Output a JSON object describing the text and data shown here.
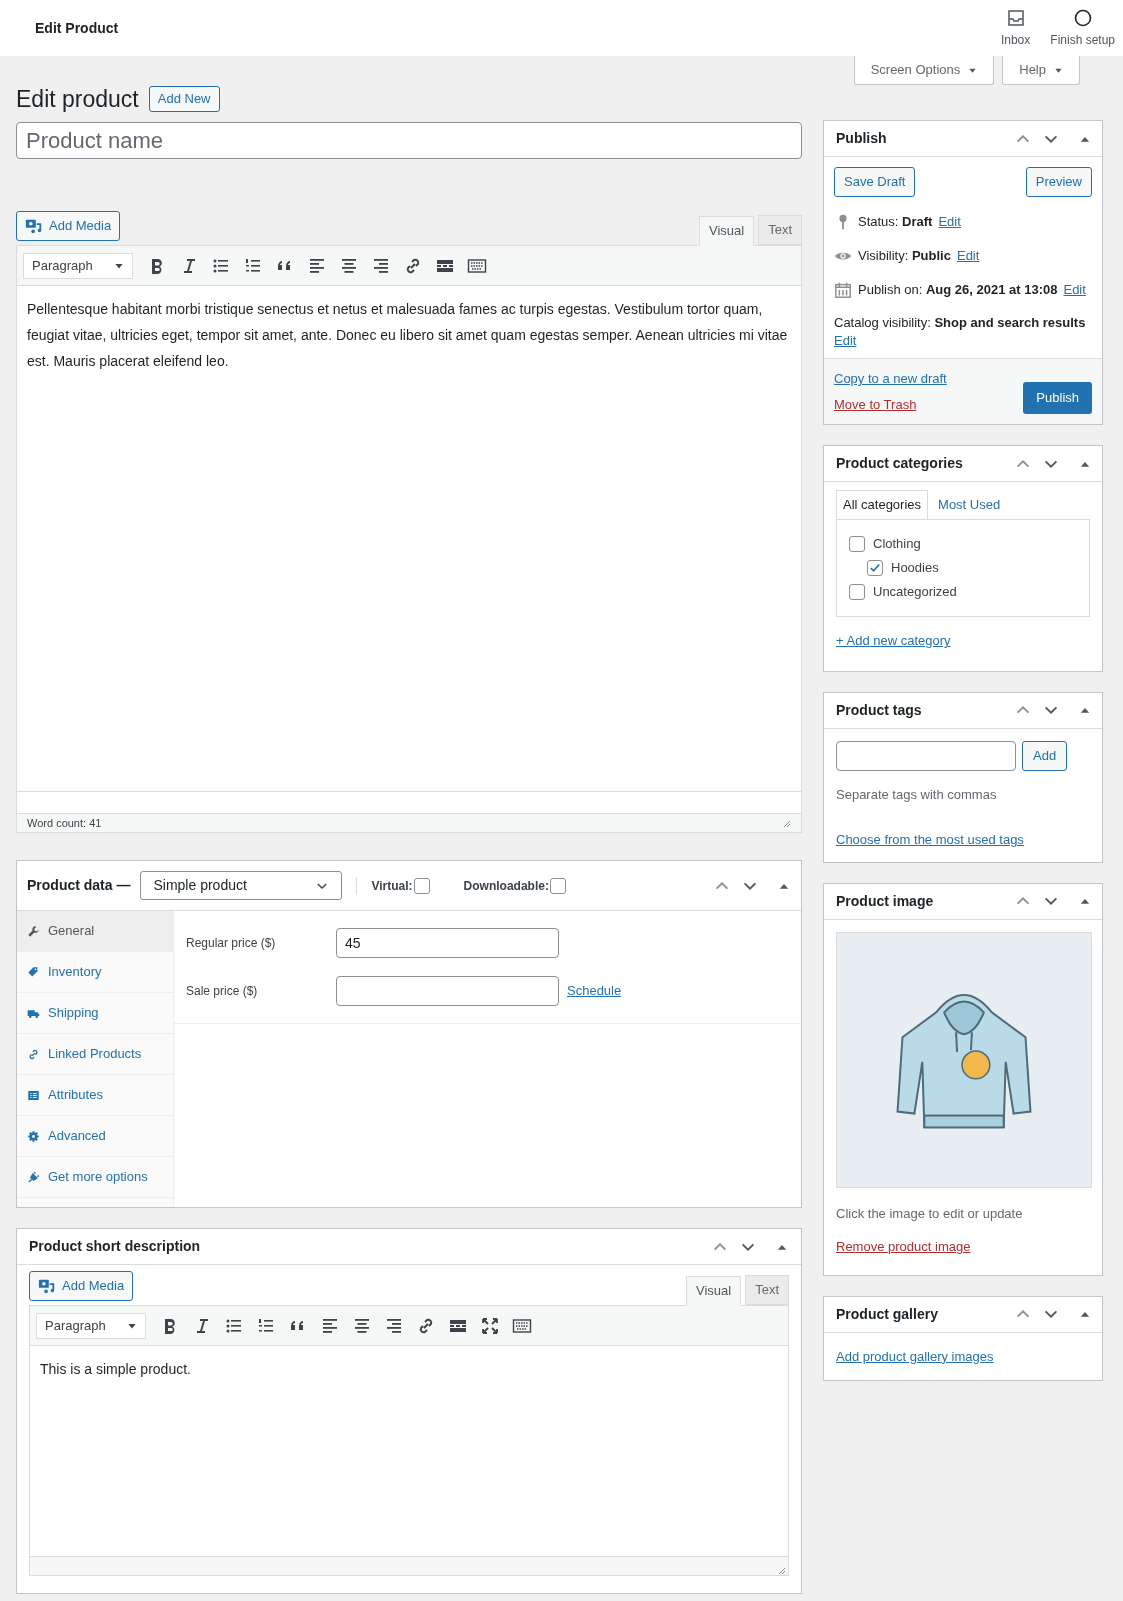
{
  "top_bar": {
    "title": "Edit Product",
    "actions": [
      {
        "label": "Inbox"
      },
      {
        "label": "Finish setup"
      }
    ]
  },
  "screen_buttons": [
    "Screen Options",
    "Help"
  ],
  "heading": {
    "title": "Edit product",
    "add_new": "Add New"
  },
  "product_name": {
    "placeholder": "Product name"
  },
  "editor": {
    "add_media": "Add Media",
    "tabs": [
      {
        "label": "Visual",
        "selected": true
      },
      {
        "label": "Text",
        "selected": false
      }
    ],
    "format": "Paragraph",
    "content": "Pellentesque habitant morbi tristique senectus et netus et malesuada fames ac turpis egestas. Vestibulum tortor quam, feugiat vitae, ultricies eget, tempor sit amet, ante. Donec eu libero sit amet quam egestas semper. Aenean ultricies mi vitae est. Mauris placerat eleifend leo.",
    "word_count": "Word count: 41"
  },
  "product_data": {
    "title": "Product data —",
    "type": "Simple product",
    "options": [
      {
        "label": "Virtual:",
        "checked": false
      },
      {
        "label": "Downloadable:",
        "checked": false
      }
    ],
    "tabs": [
      {
        "label": "General",
        "selected": true
      },
      {
        "label": "Inventory",
        "selected": false
      },
      {
        "label": "Shipping",
        "selected": false
      },
      {
        "label": "Linked Products",
        "selected": false
      },
      {
        "label": "Attributes",
        "selected": false
      },
      {
        "label": "Advanced",
        "selected": false
      },
      {
        "label": "Get more options",
        "selected": false
      }
    ],
    "fields": [
      {
        "label": "Regular price ($)",
        "value": "45"
      },
      {
        "label": "Sale price ($)",
        "link": "Schedule"
      }
    ]
  },
  "short_description": {
    "title": "Product short description",
    "add_media": "Add Media",
    "tabs": [
      {
        "label": "Visual",
        "selected": true
      },
      {
        "label": "Text",
        "selected": false
      }
    ],
    "format": "Paragraph",
    "content": "This is a simple product."
  },
  "publish": {
    "title": "Publish",
    "save_draft": "Save Draft",
    "preview": "Preview",
    "rows": [
      {
        "label": "Status:",
        "value": "Draft",
        "link": "Edit"
      },
      {
        "label": "Visibility:",
        "value": "Public",
        "link": "Edit"
      },
      {
        "label": "Publish on:",
        "value": "Aug 26, 2021 at 13:08",
        "link": "Edit"
      }
    ],
    "catalog": {
      "label": "Catalog visibility:",
      "value": "Shop and search results",
      "link": "Edit"
    },
    "copy_link": "Copy to a new draft",
    "trash_link": "Move to Trash",
    "publish_button": "Publish"
  },
  "categories": {
    "title": "Product categories",
    "tabs": [
      {
        "label": "All categories",
        "selected": true
      },
      {
        "label": "Most Used",
        "selected": false
      }
    ],
    "items": [
      {
        "label": "Clothing",
        "checked": false,
        "children": [
          {
            "label": "Hoodies",
            "checked": true
          }
        ]
      },
      {
        "label": "Uncategorized",
        "checked": false
      }
    ],
    "add_link": "+ Add new category"
  },
  "tags": {
    "title": "Product tags",
    "add_button": "Add",
    "hint": "Separate tags with commas",
    "link": "Choose from the most used tags"
  },
  "image": {
    "title": "Product image",
    "hint": "Click the image to edit or update",
    "remove_link": "Remove product image"
  },
  "gallery": {
    "title": "Product gallery",
    "link": "Add product gallery images"
  }
}
